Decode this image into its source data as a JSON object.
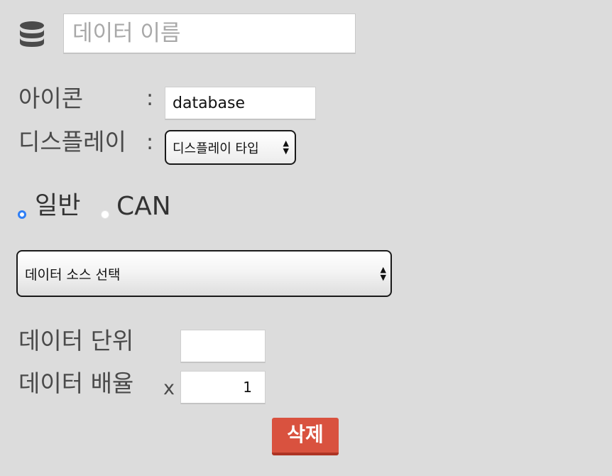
{
  "header": {
    "icon": "database-icon",
    "name_placeholder": "데이터 이름"
  },
  "icon_row": {
    "label": "아이콘",
    "colon": ":",
    "value": "database"
  },
  "display_row": {
    "label": "디스플레이",
    "colon": ":",
    "select_value": "디스플레이 타입"
  },
  "mode": {
    "options": [
      "일반",
      "CAN"
    ],
    "selected": "일반"
  },
  "data_source": {
    "select_value": "데이터 소스 선택"
  },
  "unit_row": {
    "label": "데이터 단위",
    "value": ""
  },
  "multiplier_row": {
    "label": "데이터 배율",
    "x_symbol": "x",
    "value": "1"
  },
  "delete_button": {
    "label": "삭제"
  },
  "colors": {
    "background": "#dcdcdc",
    "radio_selected": "#2f7ff5",
    "delete_button": "#d9523f"
  }
}
